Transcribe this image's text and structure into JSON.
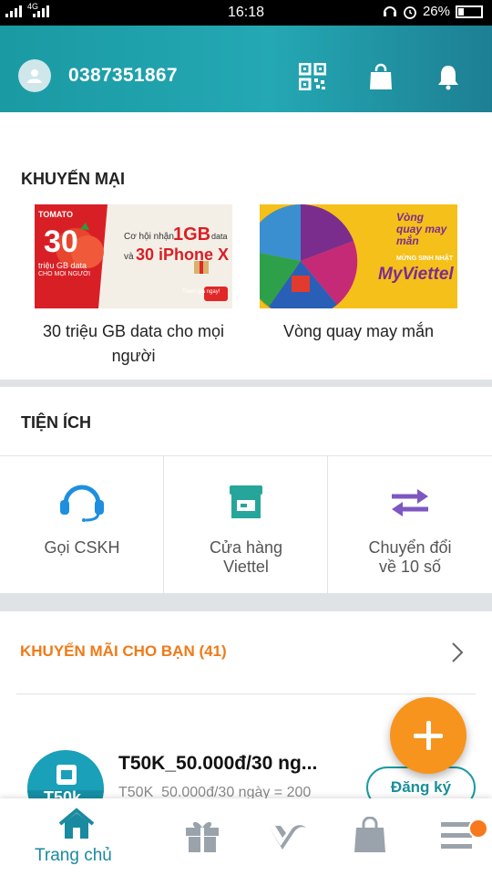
{
  "status_bar": {
    "network": "4G",
    "time": "16:18",
    "battery": "26%"
  },
  "header": {
    "phone": "0387351867"
  },
  "promotions": {
    "title": "KHUYẾN MẠI",
    "items": [
      {
        "caption_line1": "30 triệu GB data cho mọi",
        "caption_line2": "người",
        "banner_big": "30",
        "banner_text1": "triệu GB data",
        "banner_text2": "CHO MỌI NGƯỜI",
        "banner_offer1": "Cơ hội nhận",
        "banner_offer_gb": "1GB",
        "banner_offer_data": "data",
        "banner_offer2": "và",
        "banner_offer_phone": "30 iPhone X",
        "banner_button": "Tham gia ngay!",
        "banner_brand": "TOMATO"
      },
      {
        "caption_line1": "Vòng quay may mắn",
        "banner_text1": "Vòng quay may mắn",
        "banner_text2": "MỪNG SINH NHẬT",
        "banner_text3": "MyViettel"
      }
    ]
  },
  "utilities": {
    "title": "TIỆN ÍCH",
    "items": [
      {
        "line1": "Gọi CSKH",
        "line2": ""
      },
      {
        "line1": "Cửa hàng",
        "line2": "Viettel"
      },
      {
        "line1": "Chuyển đổi",
        "line2": "về 10 số"
      }
    ]
  },
  "offers": {
    "title": "KHUYẾN MÃI CHO BẠN (41)",
    "card": {
      "icon_text": "T50k",
      "title": "T50K_50.000đ/30 ng...",
      "subtitle": "T50K_50.000đ/30 ngày = 200",
      "button": "Đăng ký"
    }
  },
  "bottom_nav": {
    "home_label": "Trang chủ"
  },
  "colors": {
    "primary": "#1a9aa3",
    "accent": "#f7941d",
    "header_gradient_end": "#1d7f93"
  }
}
